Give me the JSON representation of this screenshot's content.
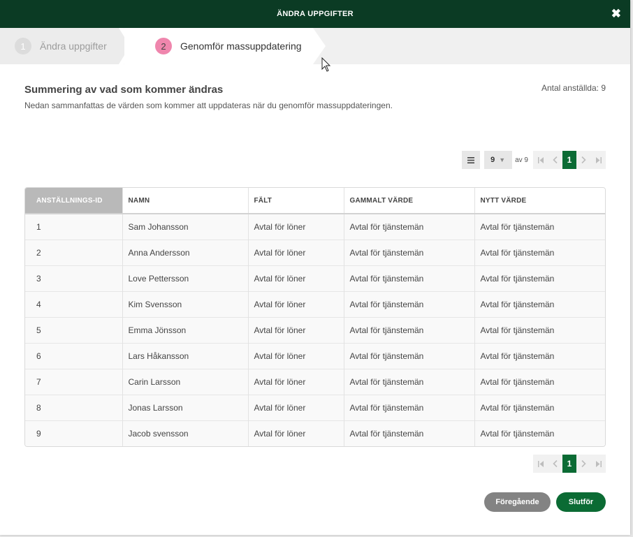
{
  "dialog": {
    "title": "ÄNDRA UPPGIFTER",
    "close_icon": "close-icon",
    "close_glyph": "✖"
  },
  "steps": [
    {
      "number": "1",
      "label": "Ändra uppgifter",
      "state": "inactive"
    },
    {
      "number": "2",
      "label": "Genomför massuppdatering",
      "state": "active"
    }
  ],
  "summary": {
    "heading": "Summering av vad som kommer ändras",
    "description": "Nedan sammanfattas de värden som kommer att uppdateras när du genomför massuppdateringen.",
    "employee_count": "Antal anställda: 9"
  },
  "pager": {
    "page_size": "9",
    "of_label": "av 9",
    "current_page": "1",
    "icons": [
      "menu-icon",
      "first-page-icon",
      "prev-page-icon",
      "next-page-icon",
      "last-page-icon"
    ]
  },
  "table": {
    "columns": [
      "ANSTÄLLNINGS-ID",
      "NAMN",
      "FÄLT",
      "GAMMALT VÄRDE",
      "NYTT VÄRDE"
    ],
    "rows": [
      [
        "1",
        "Sam Johansson",
        "Avtal för löner",
        "Avtal för tjänstemän",
        "Avtal för tjänstemän"
      ],
      [
        "2",
        "Anna Andersson",
        "Avtal för löner",
        "Avtal för tjänstemän",
        "Avtal för tjänstemän"
      ],
      [
        "3",
        "Love Pettersson",
        "Avtal för löner",
        "Avtal för tjänstemän",
        "Avtal för tjänstemän"
      ],
      [
        "4",
        "Kim Svensson",
        "Avtal för löner",
        "Avtal för tjänstemän",
        "Avtal för tjänstemän"
      ],
      [
        "5",
        "Emma Jönsson",
        "Avtal för löner",
        "Avtal för tjänstemän",
        "Avtal för tjänstemän"
      ],
      [
        "6",
        "Lars Håkansson",
        "Avtal för löner",
        "Avtal för tjänstemän",
        "Avtal för tjänstemän"
      ],
      [
        "7",
        "Carin Larsson",
        "Avtal för löner",
        "Avtal för tjänstemän",
        "Avtal för tjänstemän"
      ],
      [
        "8",
        "Jonas Larsson",
        "Avtal för löner",
        "Avtal för tjänstemän",
        "Avtal för tjänstemän"
      ],
      [
        "9",
        "Jacob svensson",
        "Avtal för löner",
        "Avtal för tjänstemän",
        "Avtal för tjänstemän"
      ]
    ]
  },
  "footer": {
    "previous_label": "Föregående",
    "finish_label": "Slutför"
  },
  "colors": {
    "header_bg": "#0b3b24",
    "accent_green": "#0b6b34",
    "active_step": "#ef86ad",
    "secondary_button": "#838383"
  }
}
